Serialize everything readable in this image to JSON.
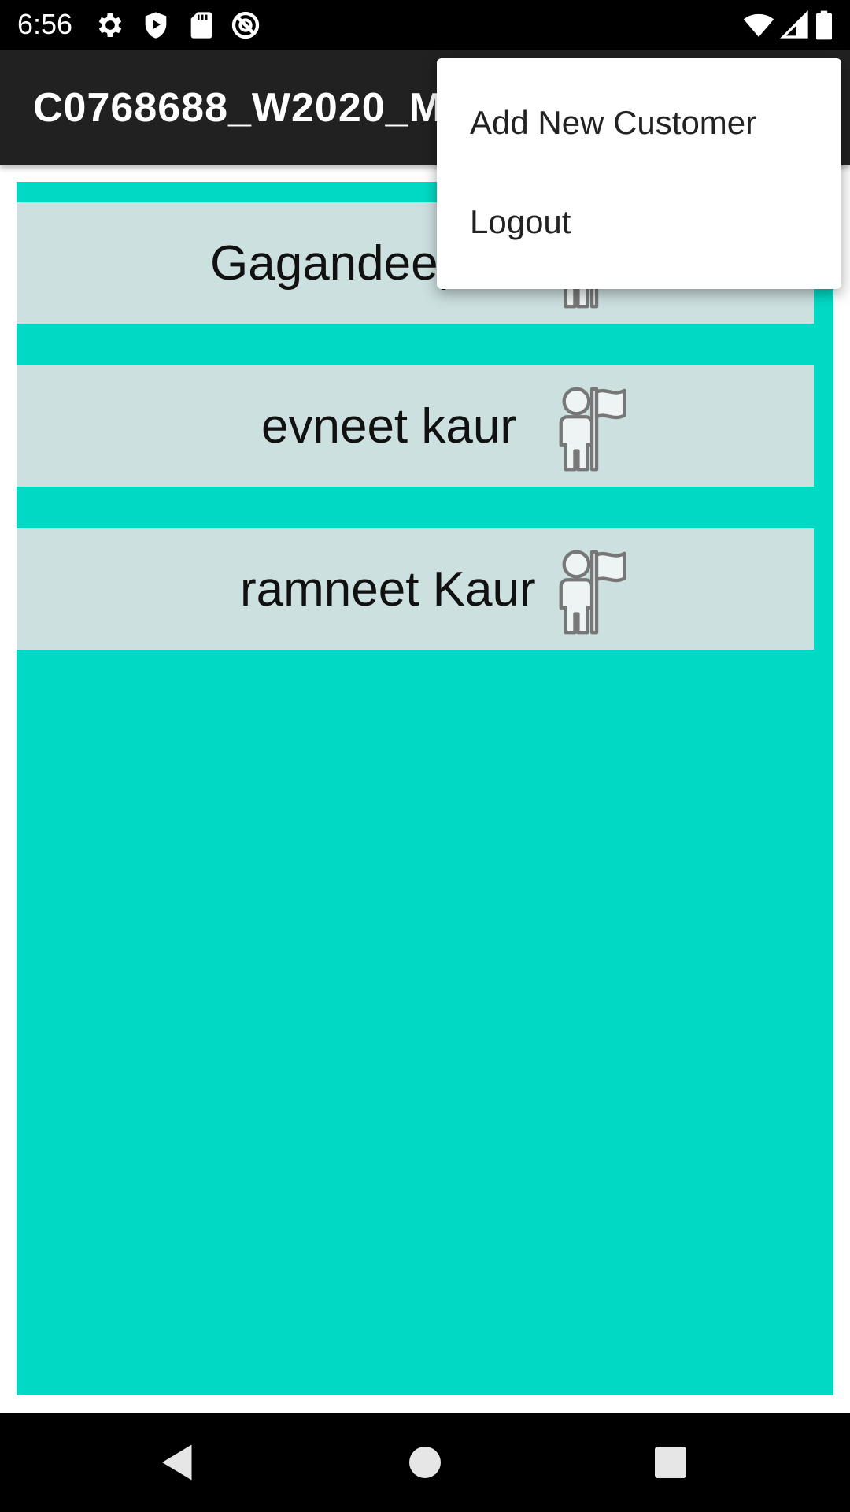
{
  "status_bar": {
    "time": "6:56",
    "left_icons": [
      "settings-gear-icon",
      "shield-play-icon",
      "sd-card-icon",
      "do-not-disturb-icon"
    ],
    "right_icons": [
      "wifi-icon",
      "cellular-signal-icon",
      "battery-icon"
    ]
  },
  "app_bar": {
    "title": "C0768688_W2020_M",
    "background": "#212121"
  },
  "content": {
    "background": "#02d9c4",
    "row_background": "#cce0e0",
    "customers": [
      {
        "name": "Gagandeep",
        "icon": "person-with-flag-icon"
      },
      {
        "name": "evneet kaur",
        "icon": "person-with-flag-icon"
      },
      {
        "name": "ramneet Kaur",
        "icon": "person-with-flag-icon"
      }
    ]
  },
  "overflow_menu": {
    "items": [
      {
        "label": "Add New Customer"
      },
      {
        "label": "Logout"
      }
    ]
  },
  "nav_bar": {
    "buttons": [
      "back-icon",
      "home-icon",
      "recents-icon"
    ]
  }
}
